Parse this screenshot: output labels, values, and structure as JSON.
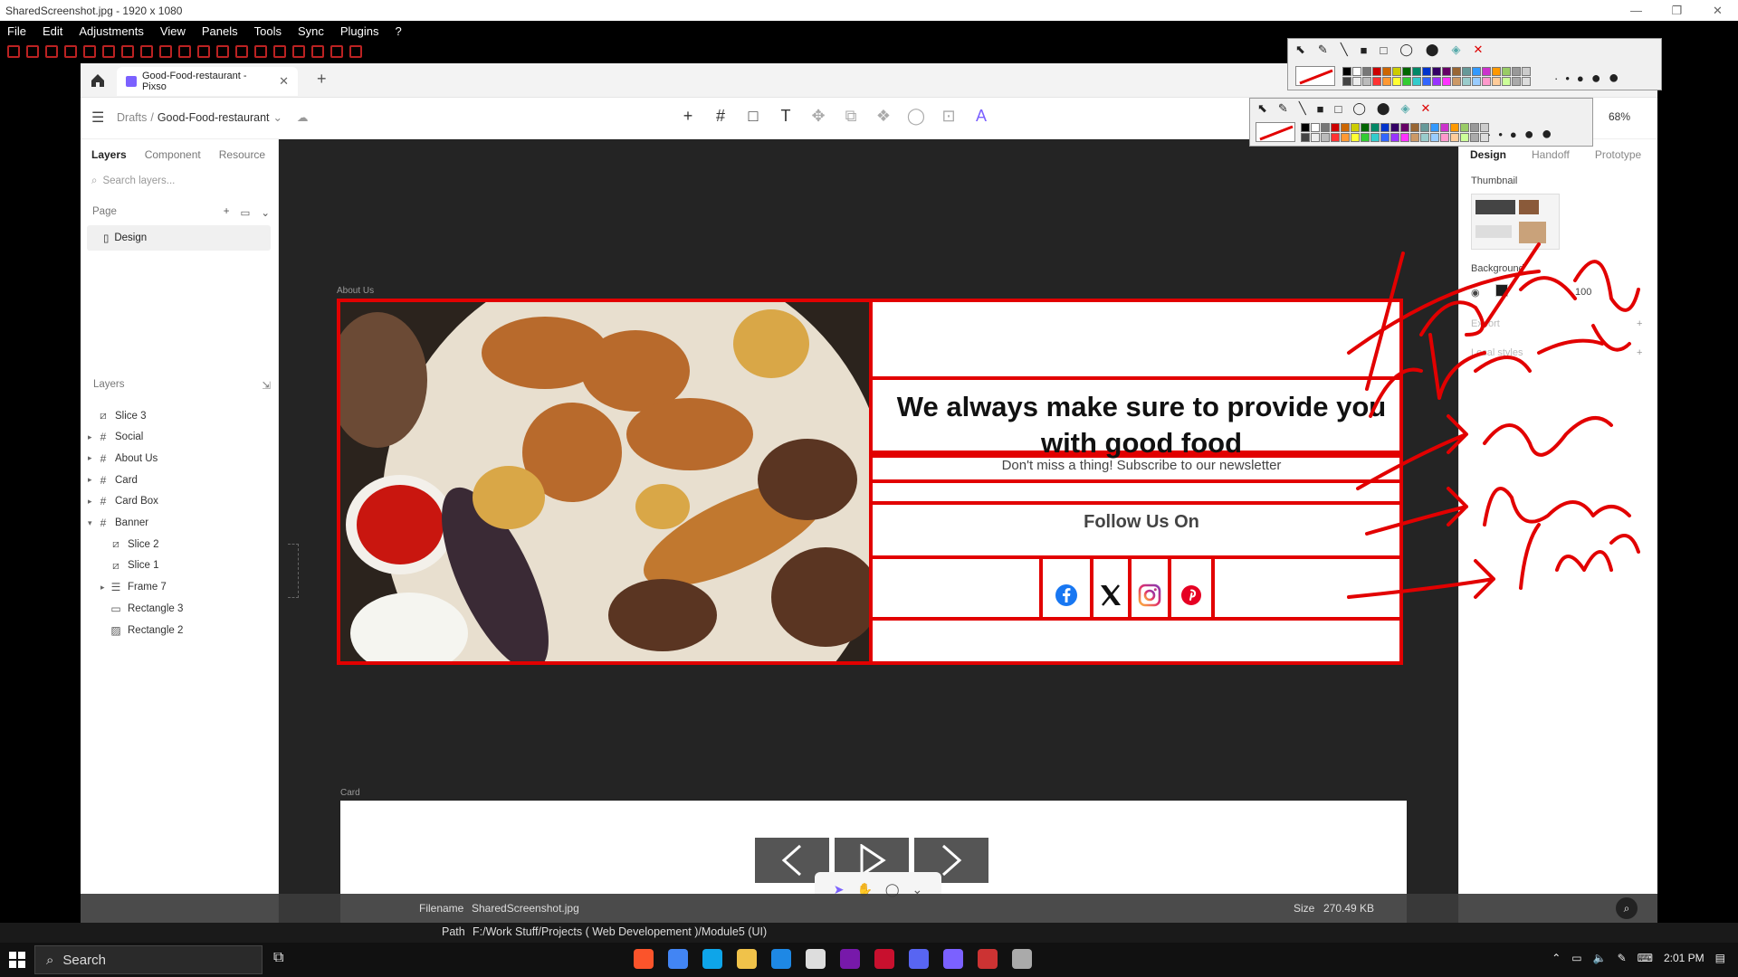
{
  "viewer": {
    "title": "SharedScreenshot.jpg - 1920 x 1080",
    "menu": [
      "File",
      "Edit",
      "Adjustments",
      "View",
      "Panels",
      "Tools",
      "Sync",
      "Plugins",
      "?"
    ],
    "filename_label": "Filename",
    "filename": "SharedScreenshot.jpg",
    "size_label": "Size",
    "size": "270.49 KB",
    "path_label": "Path",
    "path": "F:/Work Stuff/Projects ( Web Developement )/Module5 (UI)"
  },
  "app": {
    "tab_title": "Good-Food-restaurant - Pixso",
    "breadcrumb": {
      "root": "Drafts",
      "sep": "/",
      "file": "Good-Food-restaurant"
    },
    "zoom": "68%",
    "left_tabs": [
      "Layers",
      "Component",
      "Resource"
    ],
    "search_placeholder": "Search layers...",
    "page_label": "Page",
    "page_item": "Design",
    "layers_label": "Layers",
    "layers": [
      {
        "name": "Slice 3",
        "type": "slice",
        "depth": 0,
        "caret": ""
      },
      {
        "name": "Social",
        "type": "frame",
        "depth": 0,
        "caret": "▸"
      },
      {
        "name": "About Us",
        "type": "frame",
        "depth": 0,
        "caret": "▸"
      },
      {
        "name": "Card",
        "type": "frame",
        "depth": 0,
        "caret": "▸"
      },
      {
        "name": "Card Box",
        "type": "frame",
        "depth": 0,
        "caret": "▸"
      },
      {
        "name": "Banner",
        "type": "frame",
        "depth": 0,
        "caret": "▾"
      },
      {
        "name": "Slice 2",
        "type": "slice",
        "depth": 1,
        "caret": ""
      },
      {
        "name": "Slice 1",
        "type": "slice",
        "depth": 1,
        "caret": ""
      },
      {
        "name": "Frame 7",
        "type": "autolayout",
        "depth": 1,
        "caret": "▸"
      },
      {
        "name": "Rectangle 3",
        "type": "rect",
        "depth": 1,
        "caret": ""
      },
      {
        "name": "Rectangle 2",
        "type": "image",
        "depth": 1,
        "caret": ""
      }
    ],
    "right_tabs": [
      "Design",
      "Handoff",
      "Prototype"
    ],
    "thumbnail_label": "Thumbnail",
    "background_label": "Background",
    "background_opacity": "100",
    "export_label": "Export",
    "local_styles_label": "Local styles"
  },
  "canvas": {
    "about_label": "About Us",
    "heading": "We always make sure to provide you with good food",
    "paragraph": "Don't miss a thing! Subscribe to our newsletter",
    "follow": "Follow Us On",
    "social_icons": [
      "facebook-icon",
      "x-icon",
      "instagram-icon",
      "pinterest-icon"
    ],
    "card_label": "Card"
  },
  "annotations": [
    "heading",
    "Para",
    "Low",
    "border",
    "Icons"
  ],
  "taskbar": {
    "search": "Search",
    "time": "2:01 PM"
  },
  "colors": {
    "annotation_red": "#e20000",
    "pixso_accent": "#7b61ff",
    "canvas_bg": "#242424"
  }
}
